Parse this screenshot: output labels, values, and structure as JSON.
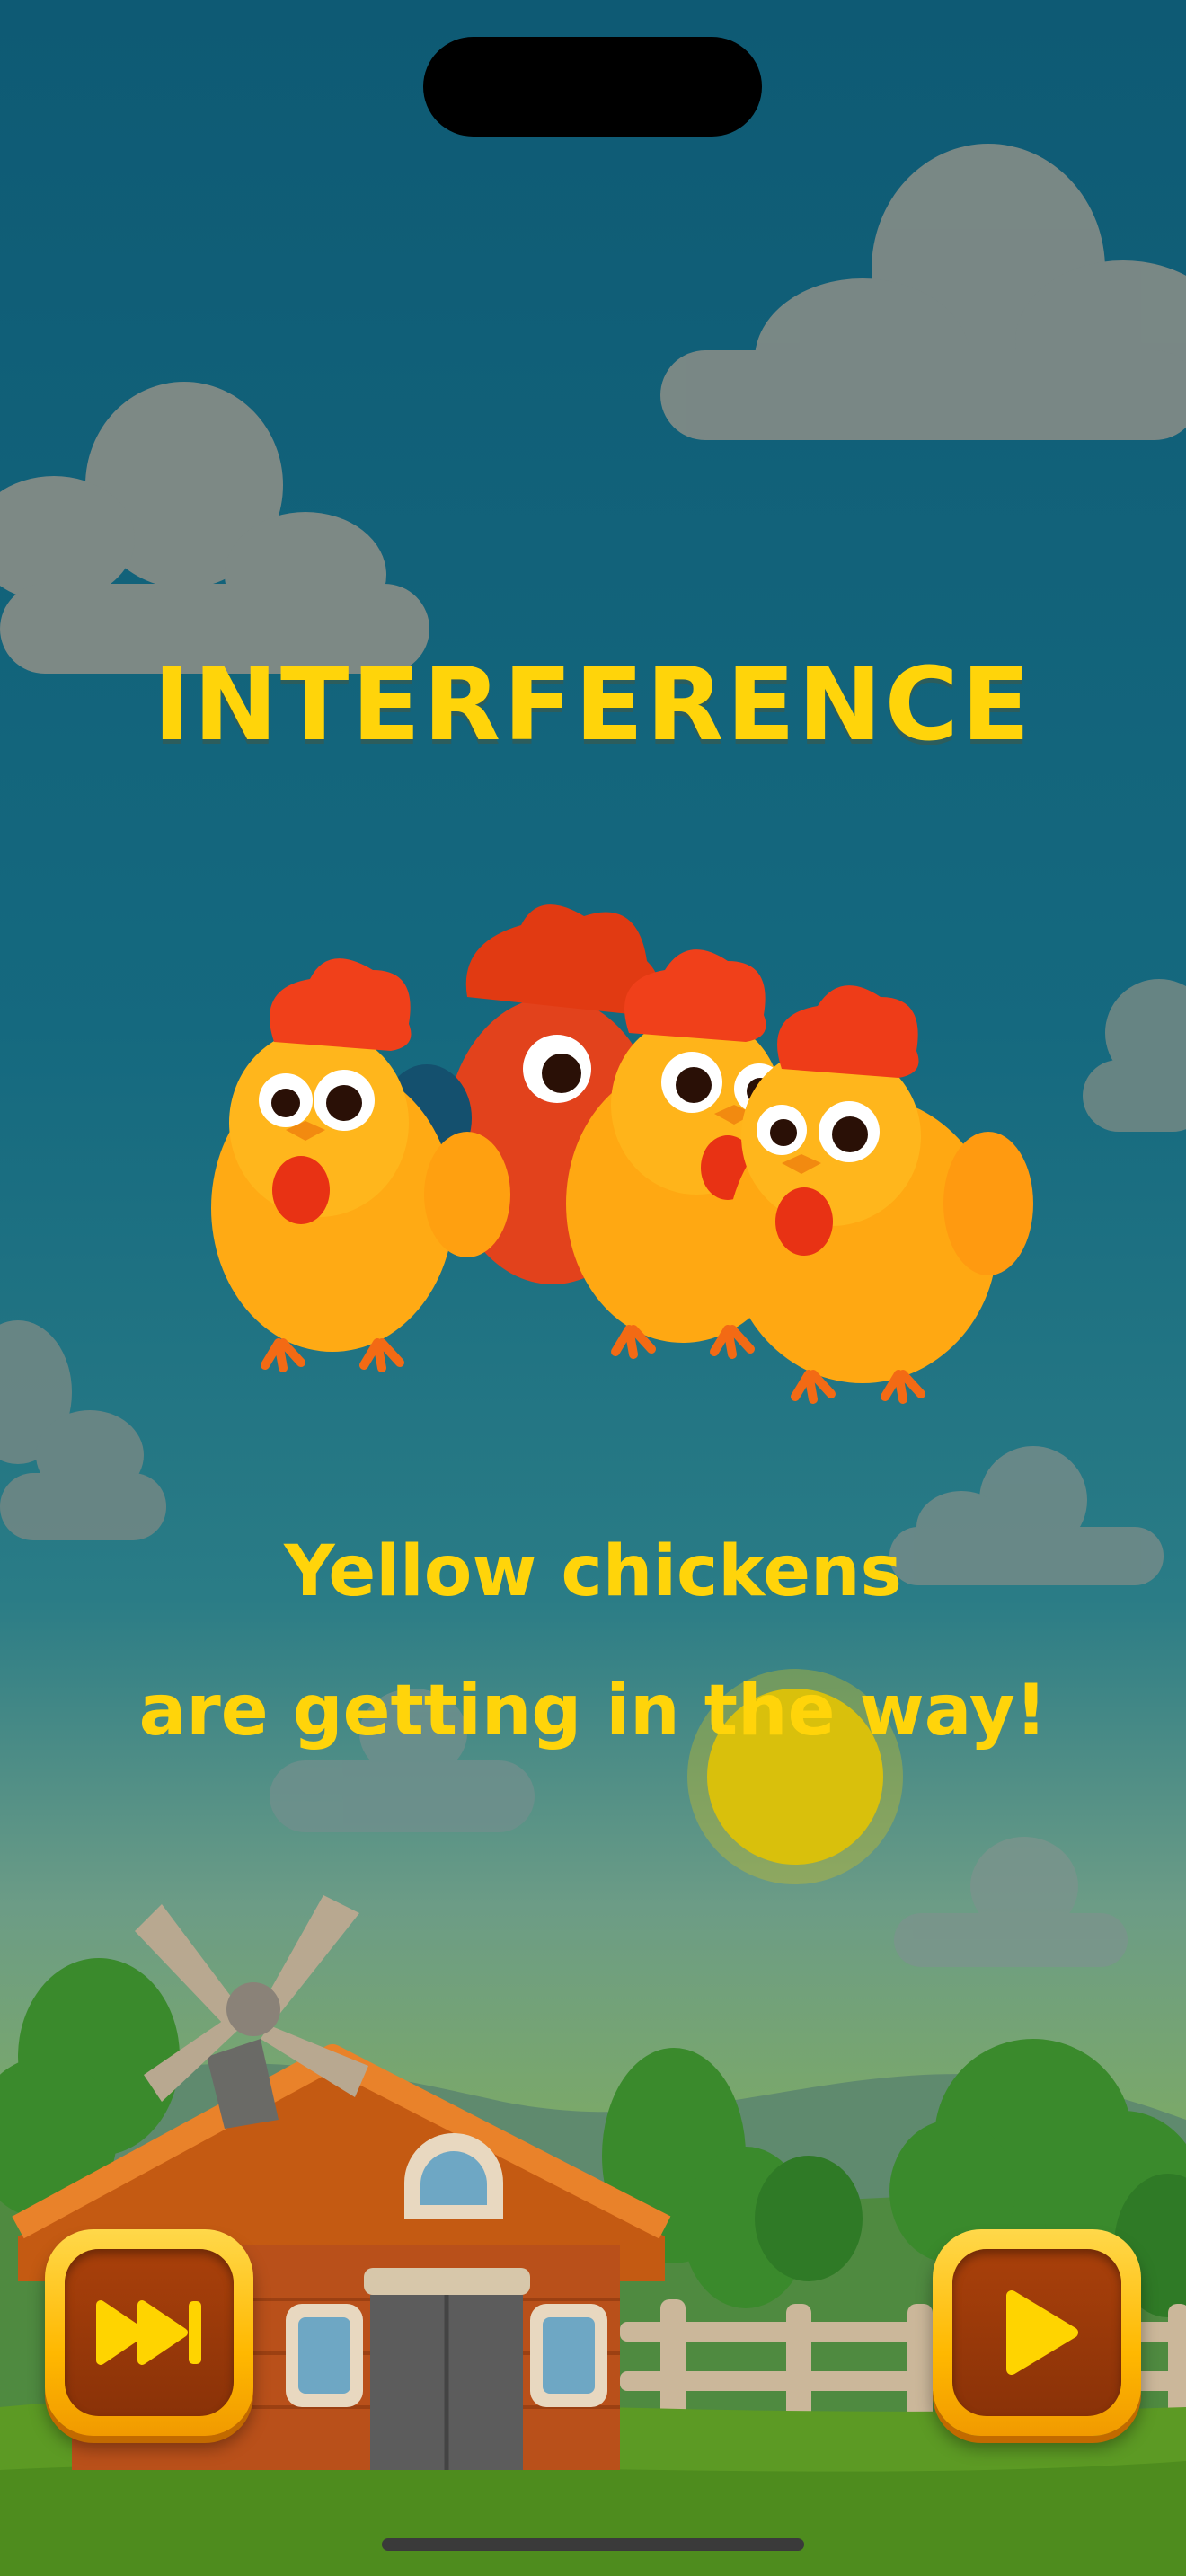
{
  "title": "INTERFERENCE",
  "message": {
    "line1": "Yellow chickens",
    "line2": "are getting in the way!"
  },
  "controls": {
    "skip_icon": "skip-forward-icon",
    "play_icon": "play-icon"
  },
  "colors": {
    "text": "#ffd40a",
    "sky": "#13637b",
    "button_outer": "#ffb800",
    "button_inner": "#9a3a08"
  }
}
